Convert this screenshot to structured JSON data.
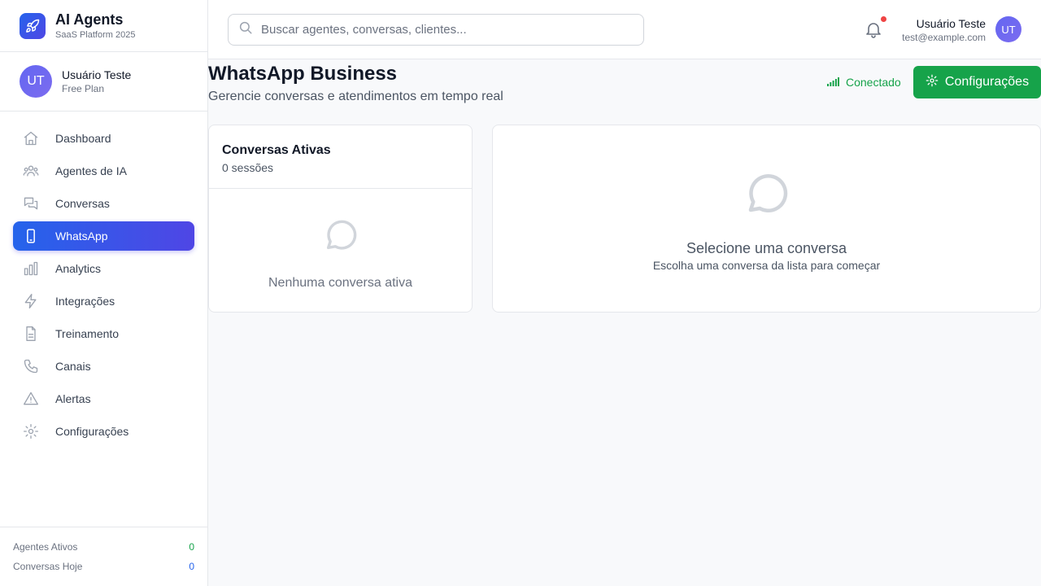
{
  "app": {
    "title": "AI Agents",
    "subtitle": "SaaS Platform 2025",
    "logo_icon": "rocket-icon"
  },
  "user": {
    "name": "Usuário Teste",
    "plan": "Free Plan",
    "initials": "UT",
    "email": "test@example.com"
  },
  "sidebar": {
    "items": [
      {
        "label": "Dashboard",
        "icon": "home-icon",
        "active": false
      },
      {
        "label": "Agentes de IA",
        "icon": "users-icon",
        "active": false
      },
      {
        "label": "Conversas",
        "icon": "chat-bubbles-icon",
        "active": false
      },
      {
        "label": "WhatsApp",
        "icon": "smartphone-icon",
        "active": true
      },
      {
        "label": "Analytics",
        "icon": "bar-chart-icon",
        "active": false
      },
      {
        "label": "Integrações",
        "icon": "zap-icon",
        "active": false
      },
      {
        "label": "Treinamento",
        "icon": "file-text-icon",
        "active": false
      },
      {
        "label": "Canais",
        "icon": "phone-icon",
        "active": false
      },
      {
        "label": "Alertas",
        "icon": "alert-triangle-icon",
        "active": false
      },
      {
        "label": "Configurações",
        "icon": "gear-icon",
        "active": false
      }
    ],
    "footer": {
      "active_agents_label": "Agentes Ativos",
      "active_agents_value": "0",
      "conversations_today_label": "Conversas Hoje",
      "conversations_today_value": "0"
    }
  },
  "header": {
    "search_placeholder": "Buscar agentes, conversas, clientes...",
    "search_value": "",
    "notification_icon": "bell-icon",
    "has_unread": true
  },
  "main": {
    "title": "WhatsApp Business",
    "subtitle": "Gerencie conversas e atendimentos em tempo real",
    "status_label": "Conectado",
    "settings_button": "Configurações",
    "conversations_card": {
      "title": "Conversas Ativas",
      "count": "0 sessões",
      "empty_text": "Nenhuma conversa ativa"
    },
    "detail_card": {
      "title": "Selecione uma conversa",
      "subtitle": "Escolha uma conversa da lista para começar"
    }
  },
  "colors": {
    "accent": "#4f46e5",
    "primary_blue": "#2563eb",
    "success": "#16a34a",
    "alert": "#ef4444"
  }
}
